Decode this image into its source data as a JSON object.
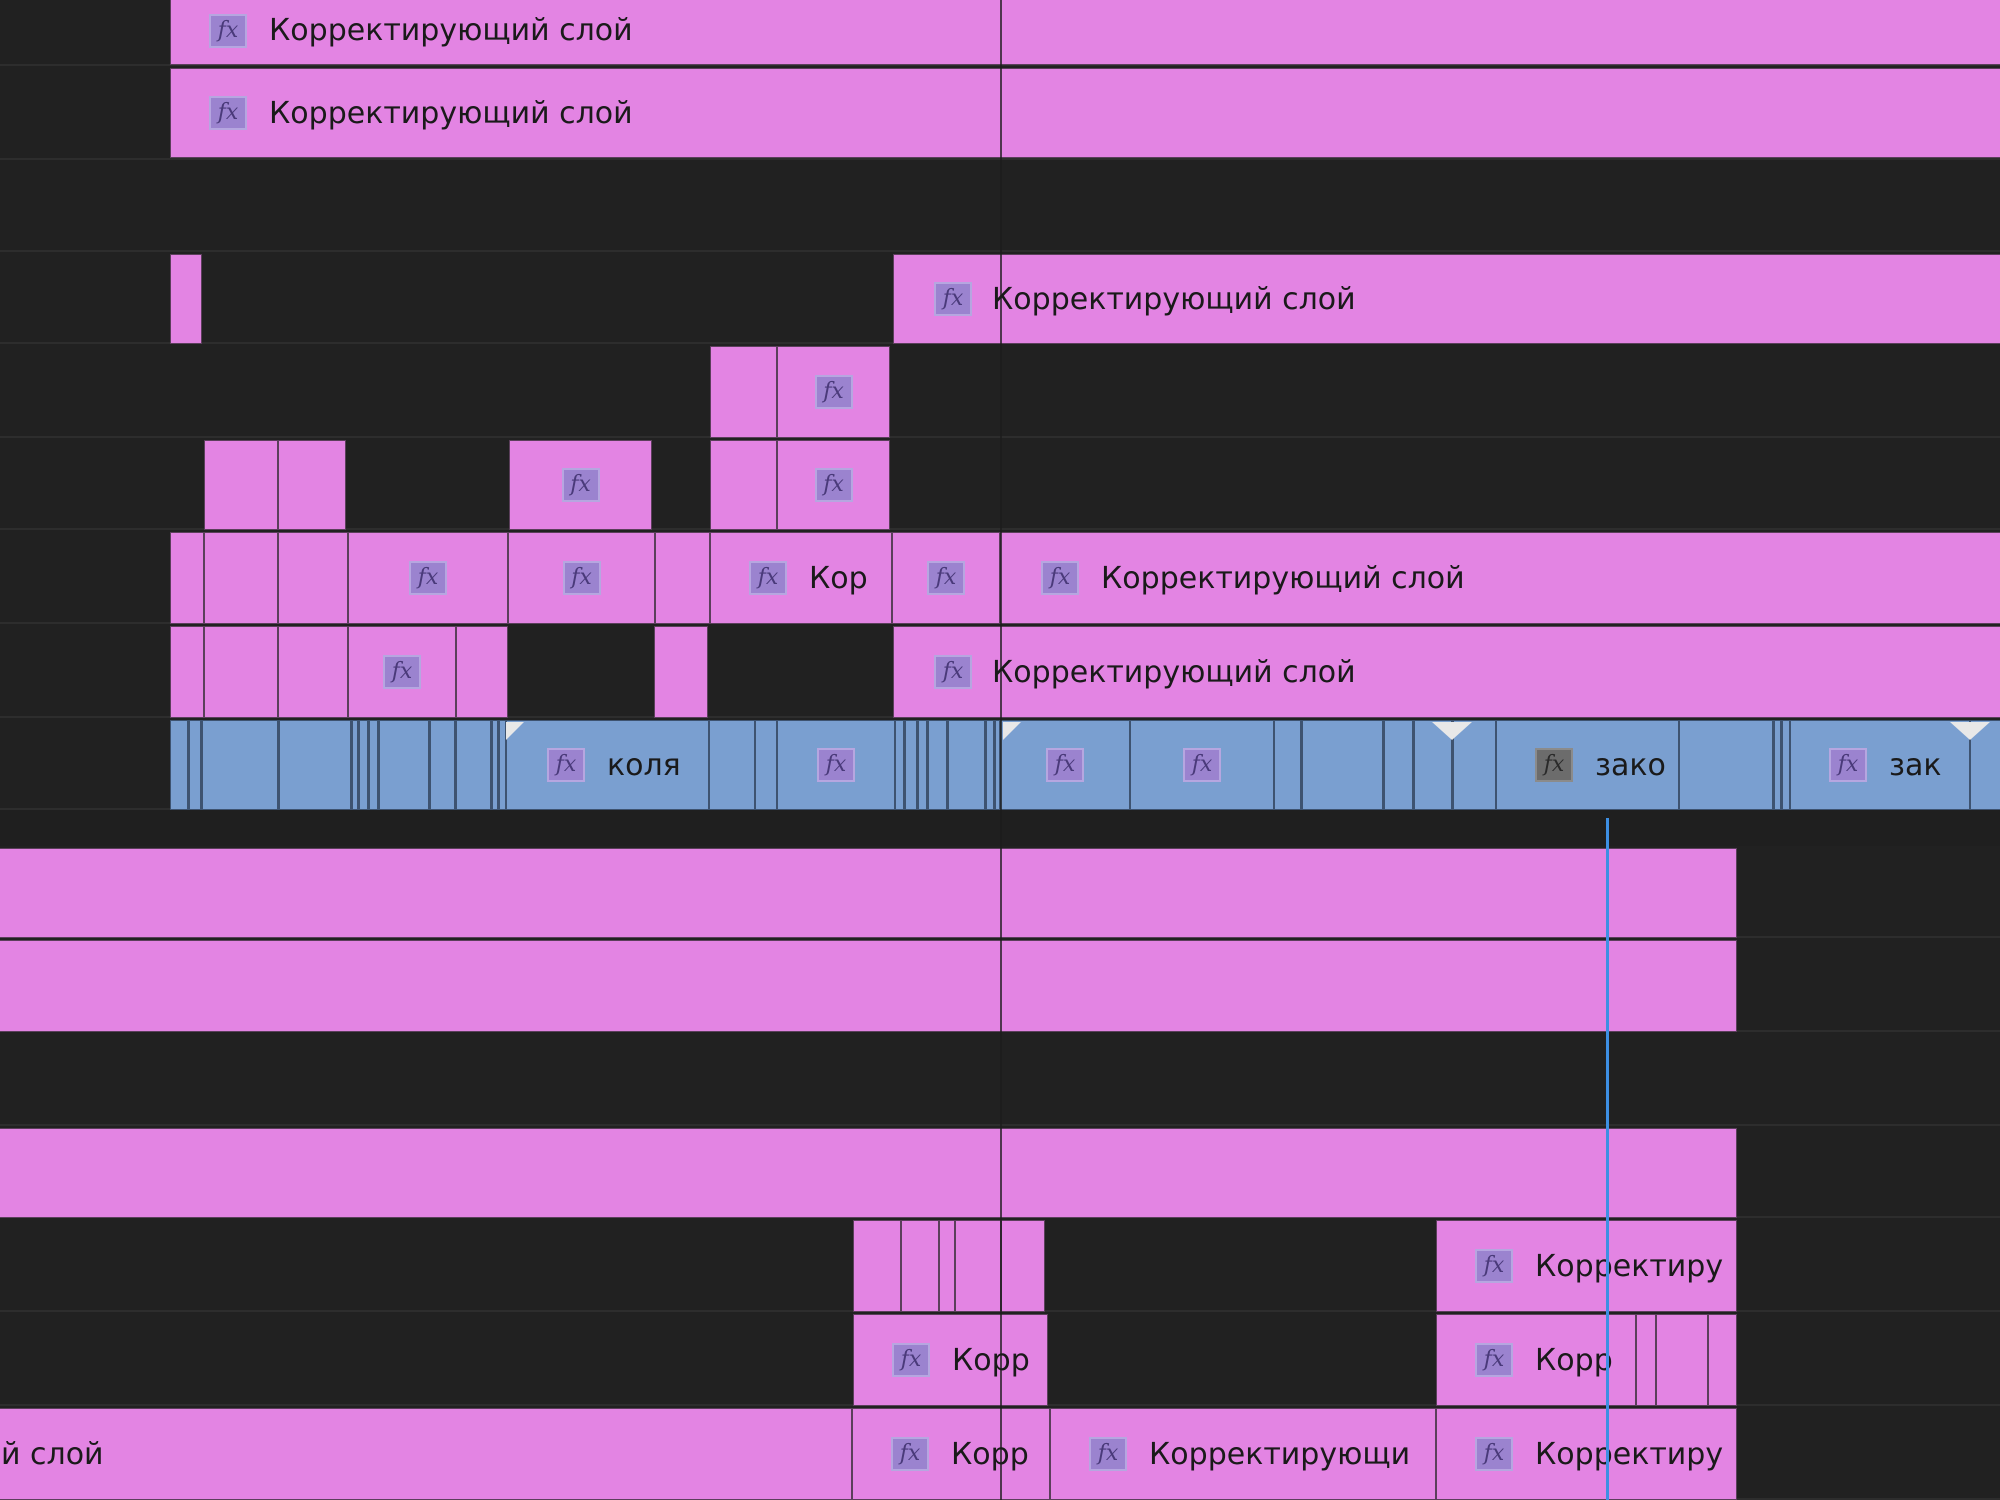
{
  "timeline": {
    "fx_glyph": "fx",
    "clip_labels": {
      "adjustment_layer": "Корректирующий слой",
      "adjustment_layer_tail": "й слой",
      "kor": "Кор",
      "korr": "Корр",
      "korrektiruyushchi": "Корректирующи",
      "korrektiru": "Корректиру",
      "kolya": "коля",
      "zako": "зако",
      "zak": "зак"
    },
    "colors": {
      "adjustment_clip": "#e384e3",
      "video_clip": "#7a9fd0",
      "track_background": "#212121",
      "playhead": "#3d8fe3"
    }
  }
}
